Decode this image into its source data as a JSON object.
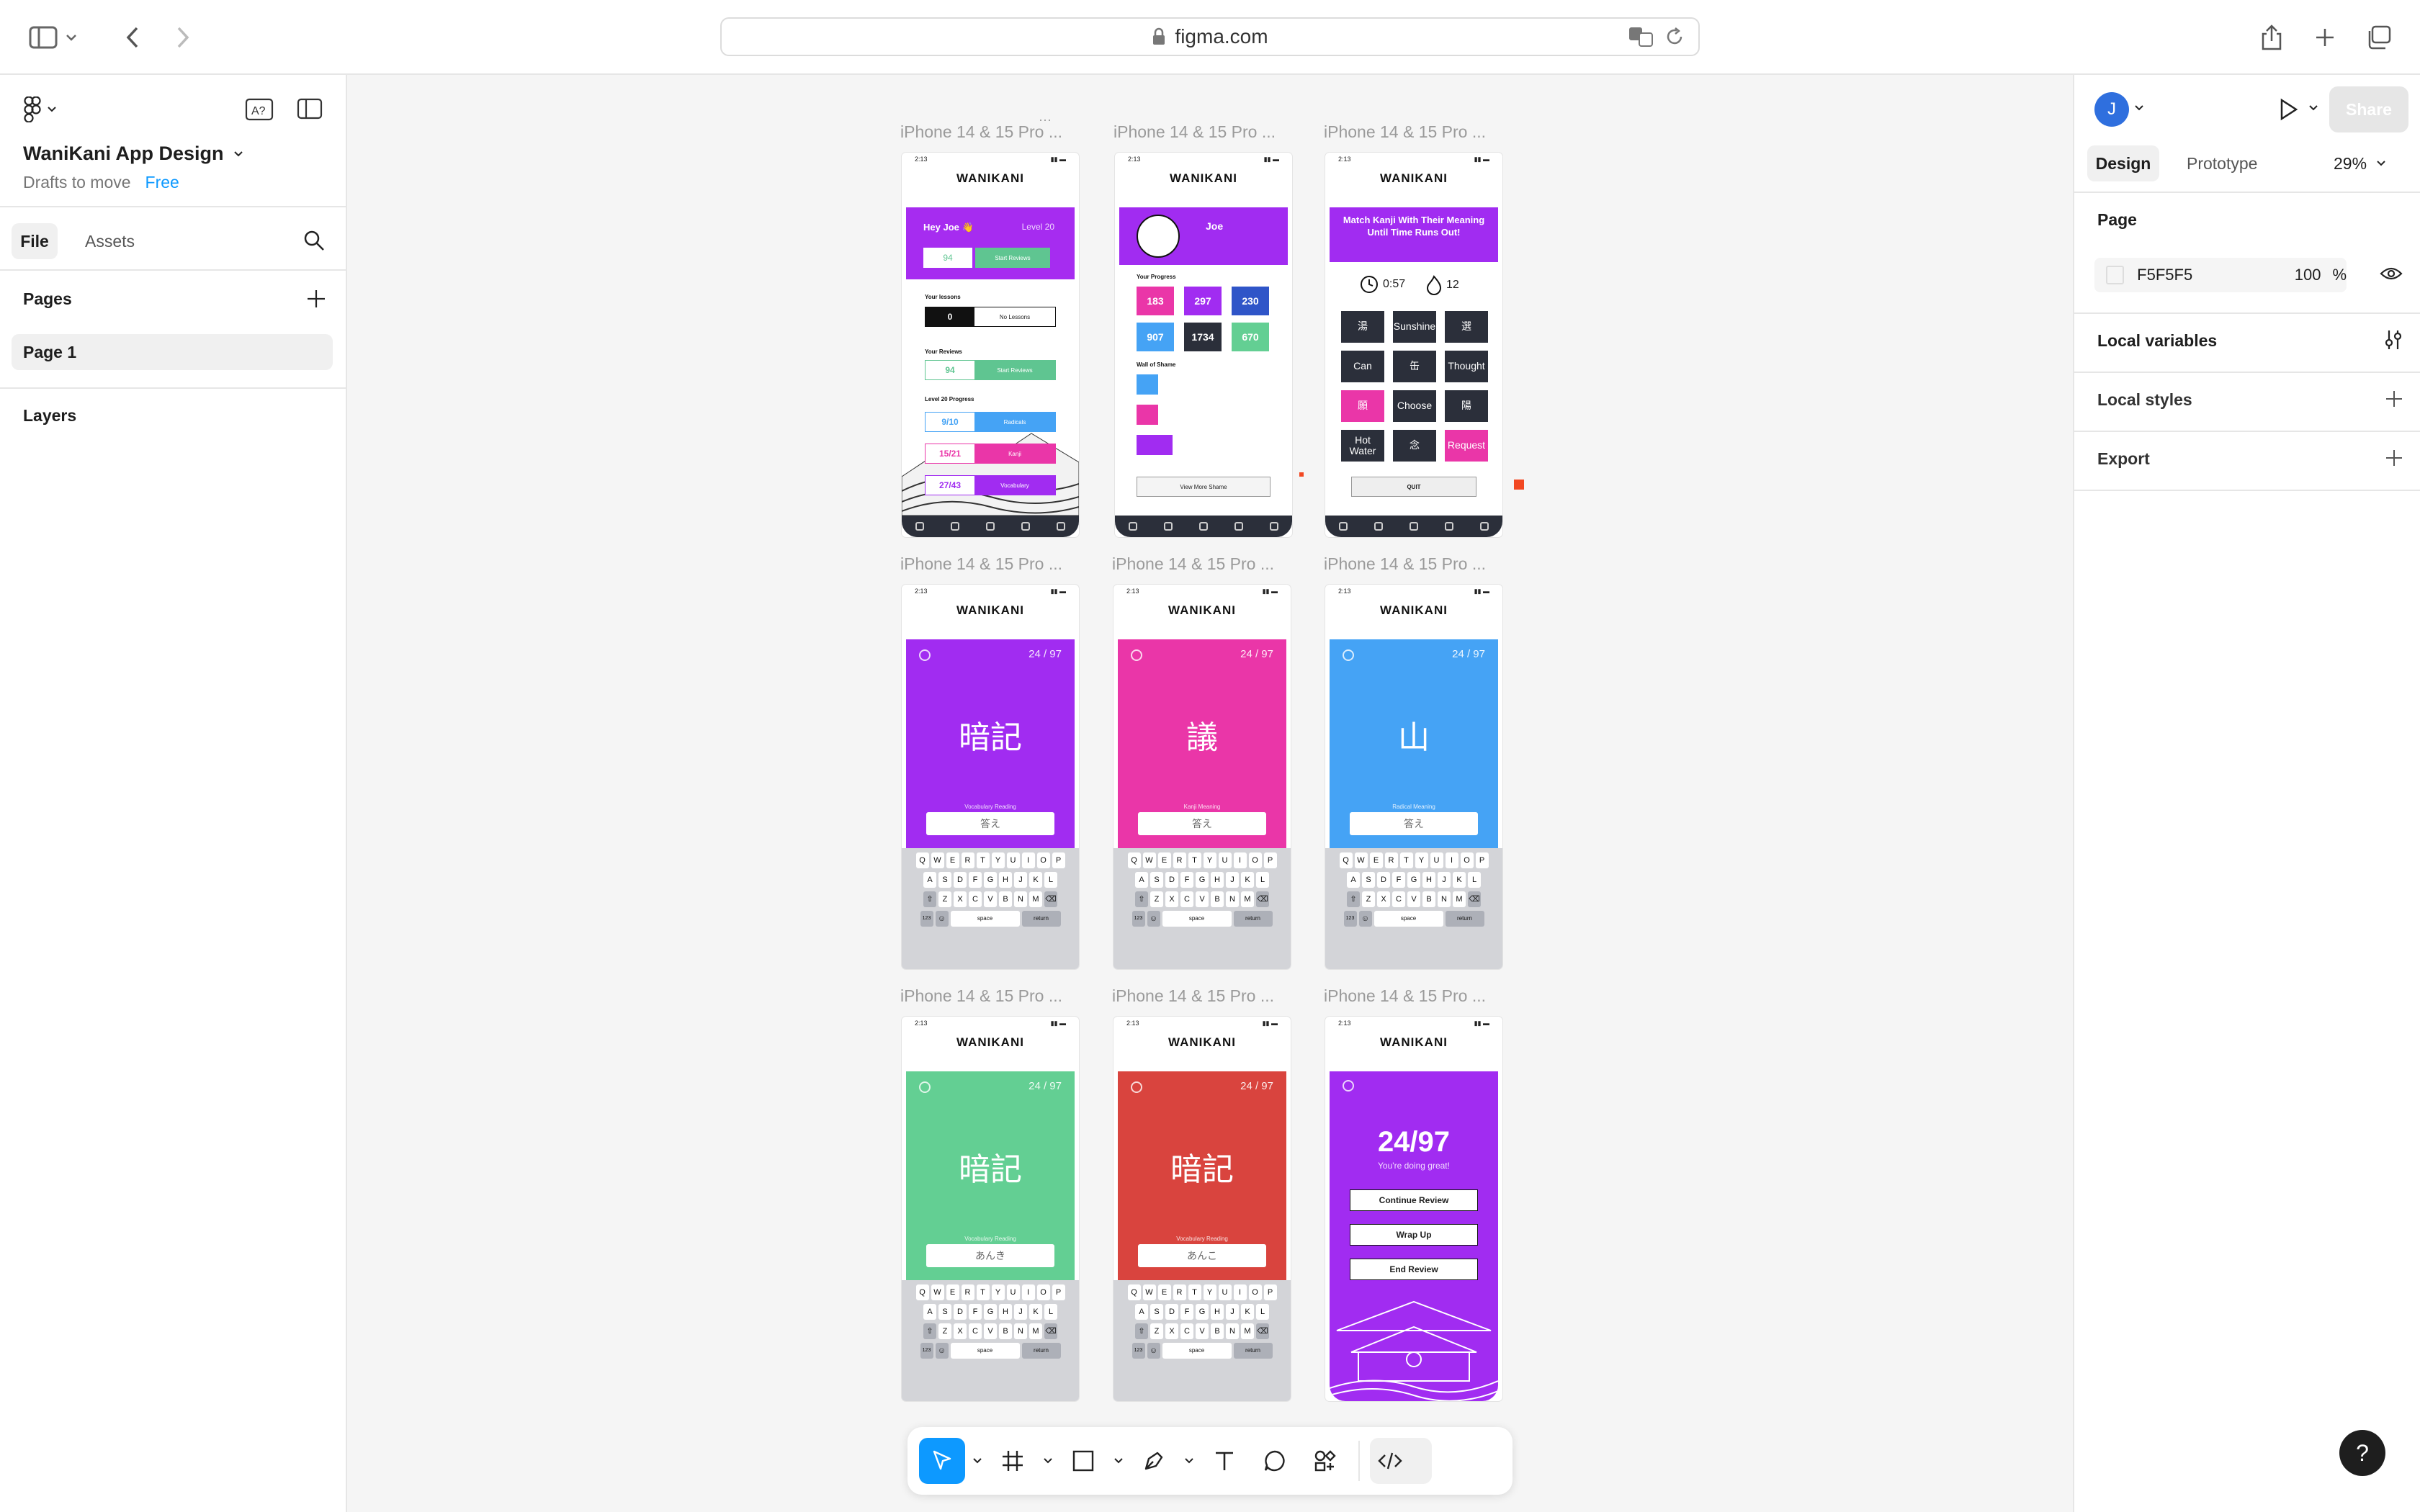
{
  "browser": {
    "url": "figma.com"
  },
  "file": {
    "title": "WaniKani App Design",
    "location": "Drafts to move",
    "plan": "Free"
  },
  "left_panel": {
    "tabs": [
      "File",
      "Assets"
    ],
    "pages_label": "Pages",
    "page_item": "Page 1",
    "layers_label": "Layers"
  },
  "right_panel": {
    "avatar_initial": "J",
    "share_label": "Share",
    "tabs": [
      "Design",
      "Prototype"
    ],
    "zoom": "29%",
    "page_section": "Page",
    "page_color": "F5F5F5",
    "page_opacity": "100",
    "page_opacity_unit": "%",
    "local_variables": "Local variables",
    "local_styles": "Local styles",
    "export": "Export"
  },
  "frames": {
    "label": "iPhone 14 & 15 Pro ...",
    "status_time": "2:13",
    "logo": "WANIKANI",
    "home": {
      "greeting": "Hey Joe 👋",
      "level": "Level 20",
      "reviews_count": "94",
      "start_reviews": "Start Reviews",
      "your_lessons": "Your lessons",
      "lessons_count": "0",
      "no_lessons": "No Lessons",
      "your_reviews": "Your Reviews",
      "progress_title": "Level 20 Progress",
      "progress": [
        {
          "count": "9/10",
          "label": "Radicals"
        },
        {
          "count": "15/21",
          "label": "Kanji"
        },
        {
          "count": "27/43",
          "label": "Vocabulary"
        }
      ]
    },
    "profile": {
      "name": "Joe",
      "your_progress": "Your Progress",
      "stats": [
        "183",
        "297",
        "230",
        "907",
        "1734",
        "670"
      ],
      "wall_of_shame": "Wall of Shame",
      "view_more": "View More Shame"
    },
    "match": {
      "title": "Match Kanji With Their Meaning Until Time Runs Out!",
      "timer": "0:57",
      "streak": "12",
      "tiles": [
        "湯",
        "Sunshine",
        "選",
        "Can",
        "缶",
        "Thought",
        "願",
        "Choose",
        "陽",
        "Hot Water",
        "念",
        "Request"
      ],
      "quit": "QUIT"
    },
    "cards": [
      {
        "kanji": "暗記",
        "kind": "Vocabulary Reading",
        "answer": "答え",
        "color": "#a12cf1"
      },
      {
        "kanji": "議",
        "kind": "Kanji Meaning",
        "answer": "答え",
        "color": "#ea36a8"
      },
      {
        "kanji": "山",
        "kind": "Radical Meaning",
        "answer": "答え",
        "color": "#45a3f5"
      },
      {
        "kanji": "暗記",
        "kind": "Vocabulary Reading",
        "answer": "あんき",
        "color": "#63cf93"
      },
      {
        "kanji": "暗記",
        "kind": "Vocabulary Reading",
        "answer": "あんこ",
        "color": "#d9443e"
      }
    ],
    "counter": "24 / 97",
    "summary": {
      "score": "24/97",
      "praise": "You're doing great!",
      "continue": "Continue Review",
      "wrap_up": "Wrap Up",
      "end": "End Review"
    },
    "keyboard": {
      "row1": [
        "Q",
        "W",
        "E",
        "R",
        "T",
        "Y",
        "U",
        "I",
        "O",
        "P"
      ],
      "row2": [
        "A",
        "S",
        "D",
        "F",
        "G",
        "H",
        "J",
        "K",
        "L"
      ],
      "row3": [
        "Z",
        "X",
        "C",
        "V",
        "B",
        "N",
        "M"
      ],
      "space": "space",
      "return": "return",
      "num": "123"
    }
  },
  "help": "?"
}
